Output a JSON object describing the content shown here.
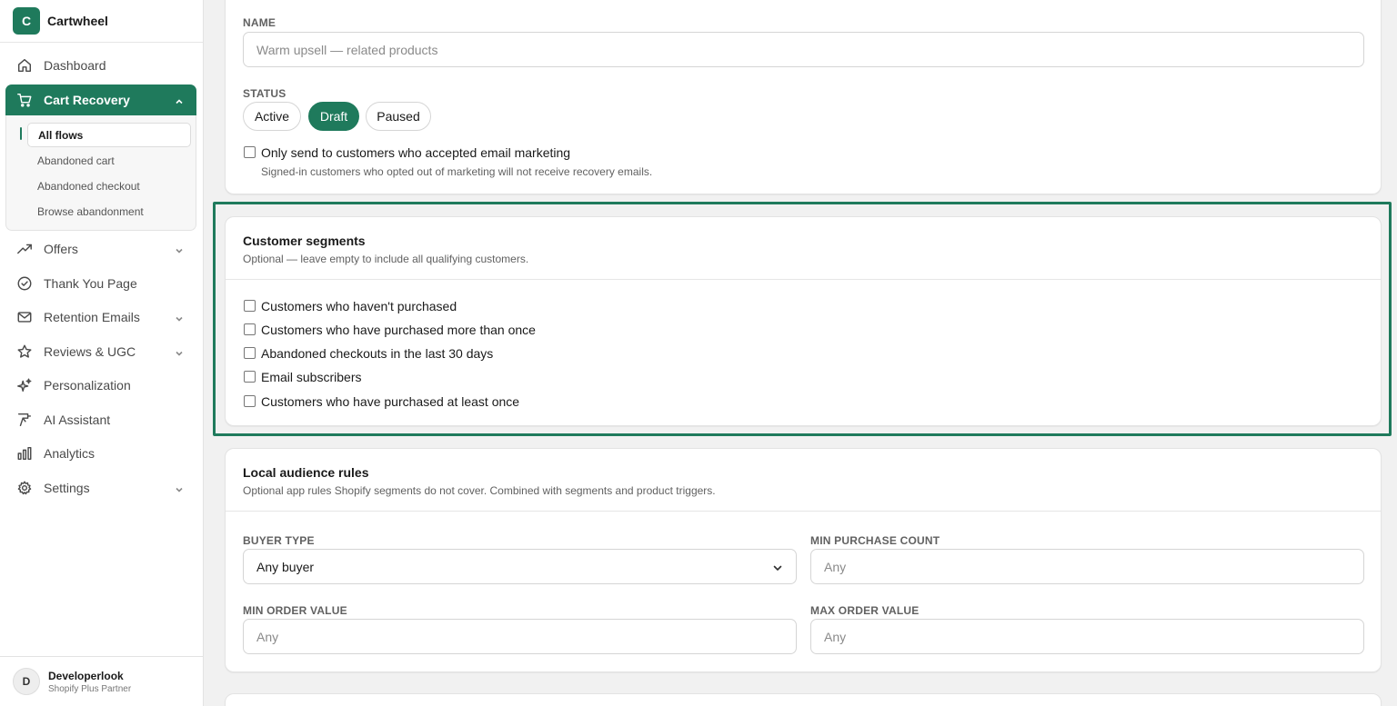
{
  "app": {
    "logo_letter": "C",
    "name": "Cartwheel"
  },
  "nav": {
    "dashboard": "Dashboard",
    "cart_recovery": "Cart Recovery",
    "cart_sub": [
      "All flows",
      "Abandoned cart",
      "Abandoned checkout",
      "Browse abandonment"
    ],
    "offers": "Offers",
    "thank_you": "Thank You Page",
    "retention": "Retention Emails",
    "reviews": "Reviews & UGC",
    "personalization": "Personalization",
    "ai": "AI Assistant",
    "analytics": "Analytics",
    "settings": "Settings"
  },
  "user": {
    "initial": "D",
    "name": "Developerlook",
    "role": "Shopify Plus Partner"
  },
  "general": {
    "name_label": "NAME",
    "name_placeholder": "Warm upsell — related products",
    "status_label": "STATUS",
    "status_options": [
      "Active",
      "Draft",
      "Paused"
    ],
    "status_selected": "Draft",
    "marketing_checkbox": "Only send to customers who accepted email marketing",
    "marketing_help": "Signed-in customers who opted out of marketing will not receive recovery emails."
  },
  "segments": {
    "title": "Customer segments",
    "subtitle": "Optional — leave empty to include all qualifying customers.",
    "options": [
      "Customers who haven't purchased",
      "Customers who have purchased more than once",
      "Abandoned checkouts in the last 30 days",
      "Email subscribers",
      "Customers who have purchased at least once"
    ]
  },
  "audience": {
    "title": "Local audience rules",
    "subtitle": "Optional app rules Shopify segments do not cover. Combined with segments and product triggers.",
    "buyer_type_label": "BUYER TYPE",
    "buyer_type_value": "Any buyer",
    "min_purchase_label": "MIN PURCHASE COUNT",
    "min_purchase_placeholder": "Any",
    "min_order_label": "MIN ORDER VALUE",
    "min_order_placeholder": "Any",
    "max_order_label": "MAX ORDER VALUE",
    "max_order_placeholder": "Any"
  },
  "colors": {
    "accent": "#1f7a5c"
  }
}
